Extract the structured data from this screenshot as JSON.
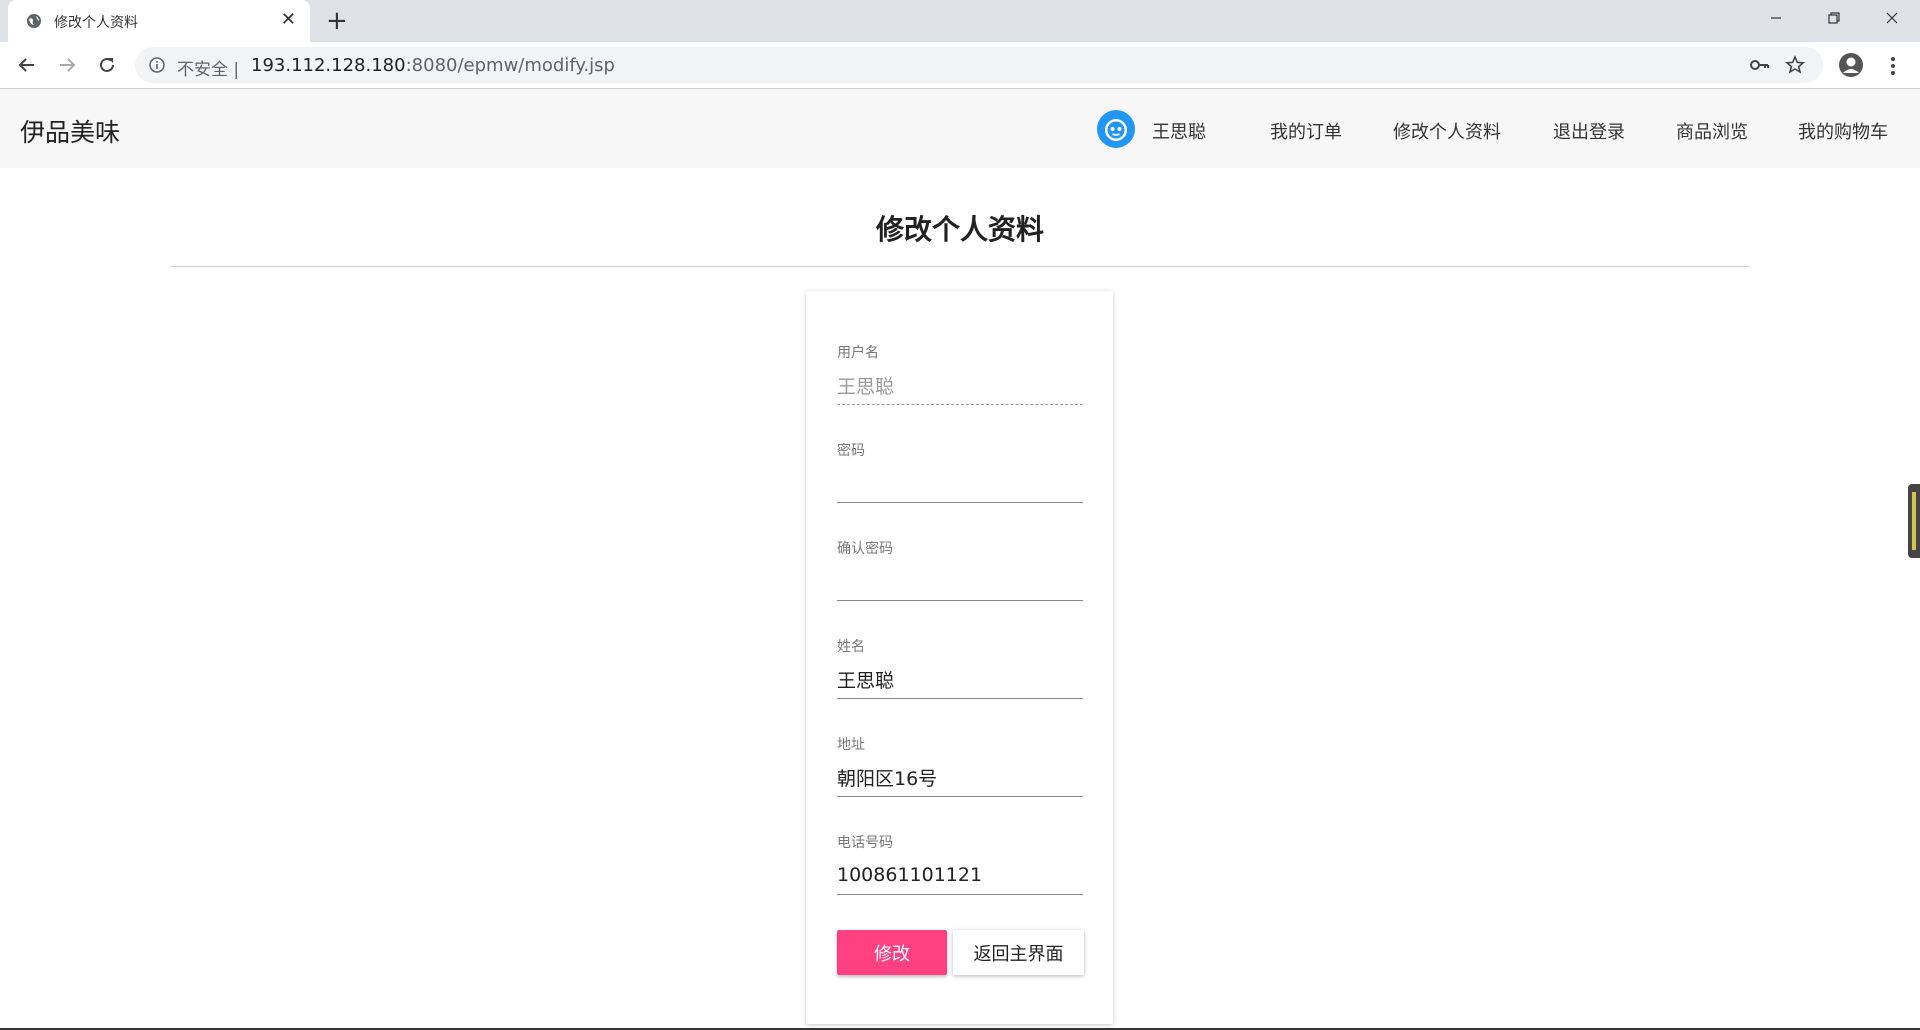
{
  "browser": {
    "tab_title": "修改个人资料",
    "tab_close": "✕",
    "new_tab": "+",
    "security_label": "不安全",
    "url_host": "193.112.128.180",
    "url_rest": ":8080/epmw/modify.jsp"
  },
  "navbar": {
    "brand": "伊品美味",
    "user_name": "王思聪",
    "links": [
      "我的订单",
      "修改个人资料",
      "退出登录",
      "商品浏览",
      "我的购物车"
    ]
  },
  "page": {
    "title": "修改个人资料"
  },
  "form": {
    "fields": [
      {
        "label": "用户名",
        "value": "王思聪",
        "disabled": true
      },
      {
        "label": "密码",
        "value": ""
      },
      {
        "label": "确认密码",
        "value": ""
      },
      {
        "label": "姓名",
        "value": "王思聪"
      },
      {
        "label": "地址",
        "value": "朝阳区16号"
      },
      {
        "label": "电话号码",
        "value": "100861101121"
      }
    ],
    "submit_label": "修改",
    "back_label": "返回主界面"
  },
  "colors": {
    "accent": "#ff4081",
    "avatar_blue": "#2196f3",
    "navbar_bg": "#f7f7f7"
  }
}
